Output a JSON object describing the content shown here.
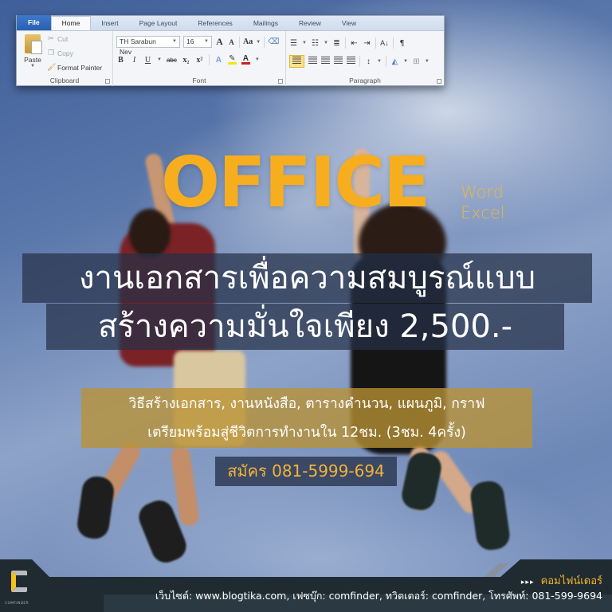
{
  "ribbon": {
    "tabs": [
      "File",
      "Home",
      "Insert",
      "Page Layout",
      "References",
      "Mailings",
      "Review",
      "View"
    ],
    "active_tab": "Home",
    "clipboard": {
      "paste_label": "Paste",
      "cut_label": "Cut",
      "copy_label": "Copy",
      "format_painter_label": "Format Painter",
      "group_label": "Clipboard"
    },
    "font": {
      "font_name": "TH Sarabun Nev",
      "font_size": "16",
      "grow_label": "A",
      "shrink_label": "A",
      "change_case_label": "Aa",
      "bold_label": "B",
      "italic_label": "I",
      "underline_label": "U",
      "strikethrough_label": "abc",
      "subscript_label": "x₂",
      "superscript_label": "x²",
      "text_effects_label": "A",
      "font_color_label": "A",
      "group_label": "Font",
      "highlight_color": "#f5e800",
      "font_color": "#d02020"
    },
    "paragraph": {
      "group_label": "Paragraph",
      "show_marks_label": "¶",
      "sort_label": "A↓",
      "active_alignment": "left"
    }
  },
  "poster": {
    "headline": "OFFICE",
    "apps": [
      "Word",
      "Excel"
    ],
    "title_lines": [
      "งานเอกสารเพื่อความสมบูรณ์แบบ",
      "สร้างความมั่นใจเพียง 2,500.-"
    ],
    "subtitle_lines": [
      "วิธีสร้างเอกสาร, งานหนังสือ, ตารางคำนวน, แผนภูมิ, กราฟ",
      "เตรียมพร้อมสู่ชีวิตการทำงานใน 12ชม. (3ชม. 4ครั้ง)"
    ],
    "cta": "สมัคร 081-5999-694",
    "colors": {
      "headline": "#f6ae1f",
      "title_box": "#263048",
      "subtitle_box": "#ba9234",
      "cta_text": "#f4b23a"
    }
  },
  "footer": {
    "logo_text": "COMFINDER",
    "brand_arrows": "▸▸▸",
    "brand_name": "คอมไฟน์เดอร์",
    "contact": "เว็บไซต์: www.blogtika.com, เฟซบุ๊ก: comfinder, ทวิตเตอร์: comfinder, โทรศัพท์: 081-599-9694",
    "colors": {
      "bar": "#1f2a31",
      "brand": "#f4b82a"
    }
  }
}
